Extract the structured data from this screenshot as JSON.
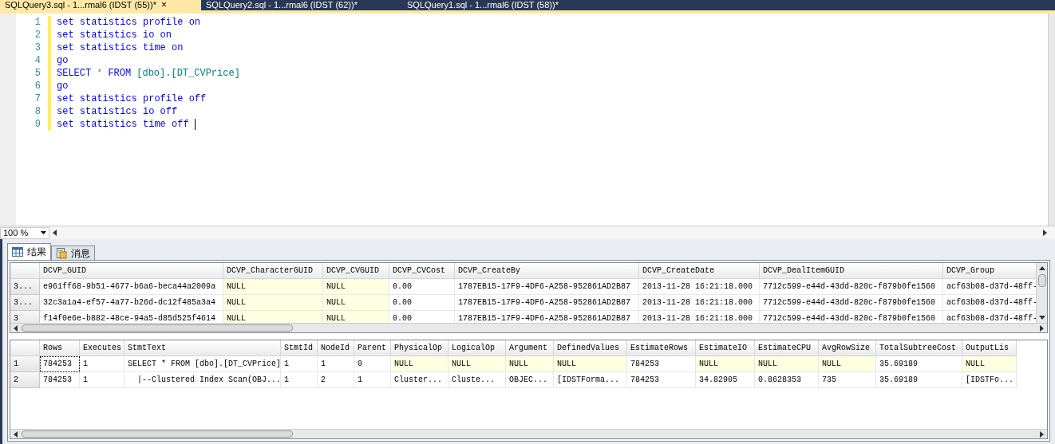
{
  "document_tabs": [
    {
      "title": "SQLQuery3.sql - 1...rmal6 (IDST (55))*",
      "selected": true,
      "close": "×"
    },
    {
      "title": "SQLQuery2.sql - 1...rmal6 (IDST (62))*",
      "selected": false
    },
    {
      "title": "SQLQuery1.sql - 1...rmal6 (IDST (58))*",
      "selected": false
    }
  ],
  "editor": {
    "lines": [
      {
        "number": "1",
        "tokens": [
          {
            "kind": "keyword",
            "text": "set statistics profile on"
          }
        ]
      },
      {
        "number": "2",
        "tokens": [
          {
            "kind": "keyword",
            "text": "set statistics io on"
          }
        ]
      },
      {
        "number": "3",
        "tokens": [
          {
            "kind": "keyword",
            "text": "set statistics time on"
          }
        ]
      },
      {
        "number": "4",
        "tokens": [
          {
            "kind": "keyword",
            "text": "go"
          }
        ]
      },
      {
        "number": "5",
        "tokens": [
          {
            "kind": "keyword",
            "text": "SELECT"
          },
          {
            "kind": "operator",
            "text": "*"
          },
          {
            "kind": "keyword",
            "text": "FROM"
          },
          {
            "kind": "identifier",
            "text": "[dbo].[DT_CVPrice]"
          }
        ]
      },
      {
        "number": "6",
        "tokens": [
          {
            "kind": "keyword",
            "text": "go"
          }
        ]
      },
      {
        "number": "7",
        "tokens": [
          {
            "kind": "keyword",
            "text": "set statistics profile off"
          }
        ]
      },
      {
        "number": "8",
        "tokens": [
          {
            "kind": "keyword",
            "text": "set statistics io off"
          }
        ]
      },
      {
        "number": "9",
        "tokens": [
          {
            "kind": "keyword",
            "text": "set statistics time off"
          }
        ],
        "cursor": true
      }
    ]
  },
  "zoom": {
    "value": "100 %"
  },
  "result_tabs": [
    {
      "label": "结果",
      "selected": true,
      "kind": "grid"
    },
    {
      "label": "消息",
      "selected": false,
      "kind": "messages"
    }
  ],
  "results_grid": {
    "columns": [
      {
        "label": "DCVP_GUID"
      },
      {
        "label": "DCVP_CharacterGUID"
      },
      {
        "label": "DCVP_CVGUID"
      },
      {
        "label": "DCVP_CVCost"
      },
      {
        "label": "DCVP_CreateBy"
      },
      {
        "label": "DCVP_CreateDate"
      },
      {
        "label": "DCVP_DealItemGUID"
      },
      {
        "label": "DCVP_Group"
      }
    ],
    "rows": [
      {
        "header": "3...",
        "cells": [
          {
            "text": "e961ff68-9b51-4677-b6a6-beca44a2009a",
            "shaded": false
          },
          {
            "text": "NULL",
            "shaded": true
          },
          {
            "text": "NULL",
            "shaded": true
          },
          {
            "text": "0.00",
            "shaded": false
          },
          {
            "text": "1787EB15-17F9-4DF6-A258-952861AD2B87",
            "shaded": false
          },
          {
            "text": "2013-11-28 16:21:18.000",
            "shaded": false
          },
          {
            "text": "7712c599-e44d-43dd-820c-f879b0fe1560",
            "shaded": false
          },
          {
            "text": "acf63b08-d37d-48ff-",
            "shaded": false
          }
        ]
      },
      {
        "header": "3...",
        "cells": [
          {
            "text": "32c3a1a4-ef57-4a77-b26d-dc12f485a3a4",
            "shaded": false
          },
          {
            "text": "NULL",
            "shaded": true
          },
          {
            "text": "NULL",
            "shaded": true
          },
          {
            "text": "0.00",
            "shaded": false
          },
          {
            "text": "1787EB15-17F9-4DF6-A258-952861AD2B87",
            "shaded": false
          },
          {
            "text": "2013-11-28 16:21:18.000",
            "shaded": false
          },
          {
            "text": "7712c599-e44d-43dd-820c-f879b0fe1560",
            "shaded": false
          },
          {
            "text": "acf63b08-d37d-48ff-",
            "shaded": false
          }
        ]
      },
      {
        "header": "3",
        "cells": [
          {
            "text": "f14f0e6e-b882-48ce-94a5-d85d525f4614",
            "shaded": false
          },
          {
            "text": "NULL",
            "shaded": true
          },
          {
            "text": "NULL",
            "shaded": true
          },
          {
            "text": "0.00",
            "shaded": false
          },
          {
            "text": "1787EB15-17F9-4DF6-A258-952861AD2B87",
            "shaded": false
          },
          {
            "text": "2013-11-28 16:21:18.000",
            "shaded": false
          },
          {
            "text": "7712c599-e44d-43dd-820c-f879b0fe1560",
            "shaded": false
          },
          {
            "text": "acf63b08-d37d-48ff-",
            "shaded": false
          }
        ]
      }
    ]
  },
  "profile_grid": {
    "columns": [
      {
        "label": "Rows"
      },
      {
        "label": "Executes"
      },
      {
        "label": "StmtText"
      },
      {
        "label": "StmtId"
      },
      {
        "label": "NodeId"
      },
      {
        "label": "Parent"
      },
      {
        "label": "PhysicalOp"
      },
      {
        "label": "LogicalOp"
      },
      {
        "label": "Argument"
      },
      {
        "label": "DefinedValues"
      },
      {
        "label": "EstimateRows"
      },
      {
        "label": "EstimateIO"
      },
      {
        "label": "EstimateCPU"
      },
      {
        "label": "AvgRowSize"
      },
      {
        "label": "TotalSubtreeCost"
      },
      {
        "label": "OutputLis"
      }
    ],
    "rows": [
      {
        "header": "1",
        "cells": [
          {
            "text": "784253",
            "shaded": false,
            "focused": true
          },
          {
            "text": "1",
            "shaded": false,
            "focused": false
          },
          {
            "text": "SELECT * FROM [dbo].[DT_CVPrice]",
            "shaded": false,
            "focused": false
          },
          {
            "text": "1",
            "shaded": false,
            "focused": false
          },
          {
            "text": "1",
            "shaded": false,
            "focused": false
          },
          {
            "text": "0",
            "shaded": false,
            "focused": false
          },
          {
            "text": "NULL",
            "shaded": true,
            "focused": false
          },
          {
            "text": "NULL",
            "shaded": true,
            "focused": false
          },
          {
            "text": "NULL",
            "shaded": true,
            "focused": false
          },
          {
            "text": "NULL",
            "shaded": true,
            "focused": false
          },
          {
            "text": "784253",
            "shaded": false,
            "focused": false
          },
          {
            "text": "NULL",
            "shaded": true,
            "focused": false
          },
          {
            "text": "NULL",
            "shaded": true,
            "focused": false
          },
          {
            "text": "NULL",
            "shaded": true,
            "focused": false
          },
          {
            "text": "35.69189",
            "shaded": false,
            "focused": false
          },
          {
            "text": "NULL",
            "shaded": true,
            "focused": false
          }
        ]
      },
      {
        "header": "2",
        "cells": [
          {
            "text": "784253",
            "shaded": false,
            "focused": false
          },
          {
            "text": "1",
            "shaded": false,
            "focused": false
          },
          {
            "text": "  |--Clustered Index Scan(OBJ...",
            "shaded": false,
            "focused": false
          },
          {
            "text": "1",
            "shaded": false,
            "focused": false
          },
          {
            "text": "2",
            "shaded": false,
            "focused": false
          },
          {
            "text": "1",
            "shaded": false,
            "focused": false
          },
          {
            "text": "Cluster...",
            "shaded": false,
            "focused": false
          },
          {
            "text": "Cluste...",
            "shaded": false,
            "focused": false
          },
          {
            "text": "OBJEC...",
            "shaded": false,
            "focused": false
          },
          {
            "text": "[IDSTForma...",
            "shaded": false,
            "focused": false
          },
          {
            "text": "784253",
            "shaded": false,
            "focused": false
          },
          {
            "text": "34.82905",
            "shaded": false,
            "focused": false
          },
          {
            "text": "0.8628353",
            "shaded": false,
            "focused": false
          },
          {
            "text": "735",
            "shaded": false,
            "focused": false
          },
          {
            "text": "35.69189",
            "shaded": false,
            "focused": false
          },
          {
            "text": "[IDSTFo...",
            "shaded": false,
            "focused": false
          }
        ]
      }
    ]
  }
}
